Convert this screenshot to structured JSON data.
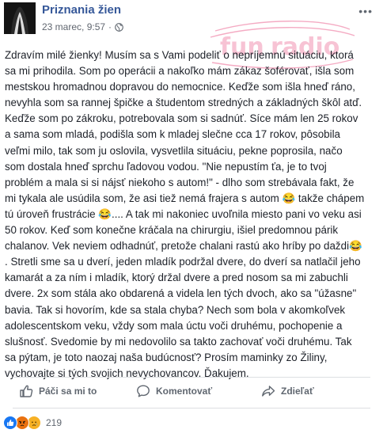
{
  "post": {
    "page_name": "Priznania žien",
    "timestamp": "23 marec, 9:57",
    "more_icon": "more-dots-icon",
    "privacy_icon": "globe-icon",
    "watermark": "funradio",
    "text": "Zdravím milé žienky! Musím sa s Vami podeliť o nepríjemnú situáciu, ktorá\nsa mi prihodila. Som po operácii a nakoľko mám zákaz šoférovať, išla som\nmestskou hromadnou dopravou do nemocnice. Keďže som išla hneď ráno,\nnevyhla som sa rannej špičke a študentom stredných a základných škôl atď.\nKeďže som po zákroku, potrebovala som si sadnúť. Síce mám len 25 rokov\na sama som mladá, podišla som k mladej slečne cca 17 rokov, pôsobila\nveľmi milo, tak som ju oslovila, vysvetlila situáciu, pekne poprosila, načo\nsom dostala hneď sprchu ľadovou vodou. \"Nie nepustím ťa, je to tvoj\nproblém a mala si si nájsť niekoho s autom!\" - dlho som strebávala fakt, že\nmi tykala ale usúdila som, že asi tiež nemá frajera s autom 😂 takže chápem\ntú úroveň frustrácie 😂.... A tak mi nakoniec uvoľnila miesto pani vo veku asi\n50 rokov. Keď som konečne kráčala na chirurgiu, išiel predomnou párik\nchalanov. Vek neviem odhadnúť, pretože chalani rastú ako hríby po daždi😂\n. Stretli sme sa u dverí, jeden mladík podržal dvere, do dverí sa natlačil jeho\nkamarát a za ním i mladík, ktorý držal dvere a pred nosom sa mi zabuchli\ndvere. 2x som stála ako obdarená a videla len tých dvoch, ako sa \"úžasne\"\nbavia. Tak si hovorím, kde sa stala chyba? Nech som bola v akomkoľvek\nadolescentskom veku, vždy som mala úctu voči druhému, pochopenie a\nslušnosť. Svedomie by mi nedovolilo sa takto zachovať voči druhému. Tak\nsa pýtam, je toto naozaj naša budúcnosť? Prosím maminky zo Žiliny,\nvychovajte si tých svojich nevychovancov. Ďakujem."
  },
  "actions": {
    "like_label": "Páči sa mi to",
    "comment_label": "Komentovať",
    "share_label": "Zdieľať",
    "like_icon": "thumbs-up-icon",
    "comment_icon": "speech-bubble-icon",
    "share_icon": "share-arrow-icon"
  },
  "reactions": {
    "count": "219",
    "types": [
      "like",
      "angry",
      "sad"
    ]
  },
  "colors": {
    "link": "#365899",
    "text": "#1d2129",
    "muted": "#606770",
    "like_blue": "#1877f2",
    "angry": "#e9710f",
    "sad_yellow": "#f7b125",
    "watermark_pink": "#e8467c"
  }
}
